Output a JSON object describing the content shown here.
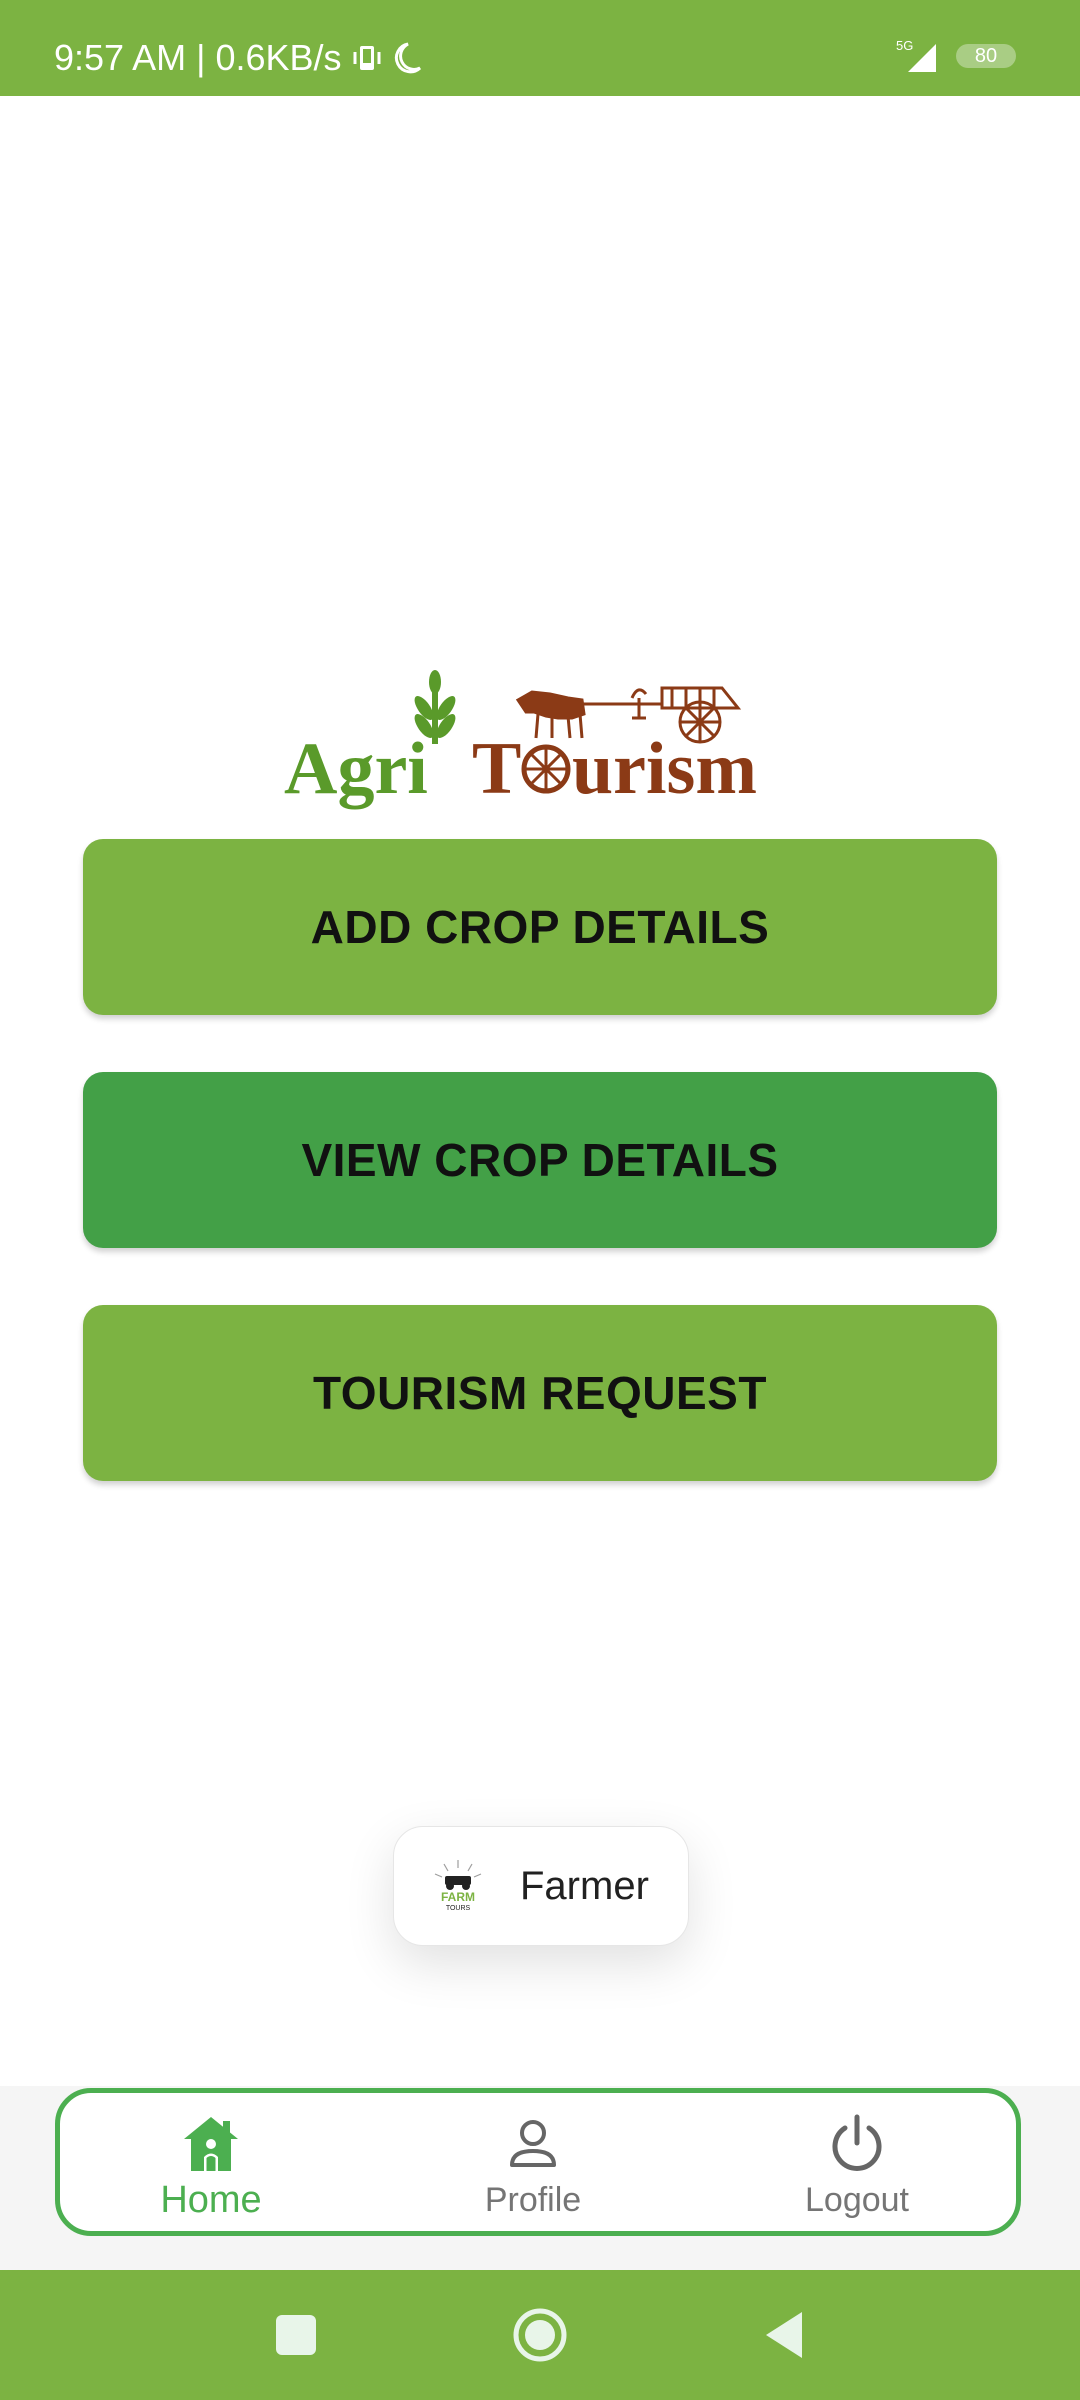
{
  "status_bar": {
    "time_speed": "9:57 AM | 0.6KB/s",
    "network": "5G",
    "battery": "80"
  },
  "logo": {
    "word1": "Agri",
    "word2_t": "T",
    "word2_rest": "urism"
  },
  "buttons": {
    "add_crop": "ADD CROP DETAILS",
    "view_crop": "VIEW CROP DETAILS",
    "tourism_request": "TOURISM REQUEST"
  },
  "toast": {
    "text": "Farmer",
    "icon_word": "FARM",
    "icon_subword": "TOURS"
  },
  "bottom_nav": {
    "home": "Home",
    "profile": "Profile",
    "logout": "Logout"
  },
  "colors": {
    "primary_green": "#7cb342",
    "dark_green": "#43a047",
    "active_nav": "#4caf50",
    "logo_green": "#5a9a2a",
    "logo_brown": "#8b3a16"
  },
  "icons": {
    "status": [
      "vibrate-icon",
      "moon-icon",
      "signal-icon",
      "battery-icon"
    ],
    "nav": [
      "home-icon",
      "profile-icon",
      "power-icon"
    ],
    "system": [
      "recent-apps-icon",
      "home-circle-icon",
      "back-icon"
    ]
  }
}
